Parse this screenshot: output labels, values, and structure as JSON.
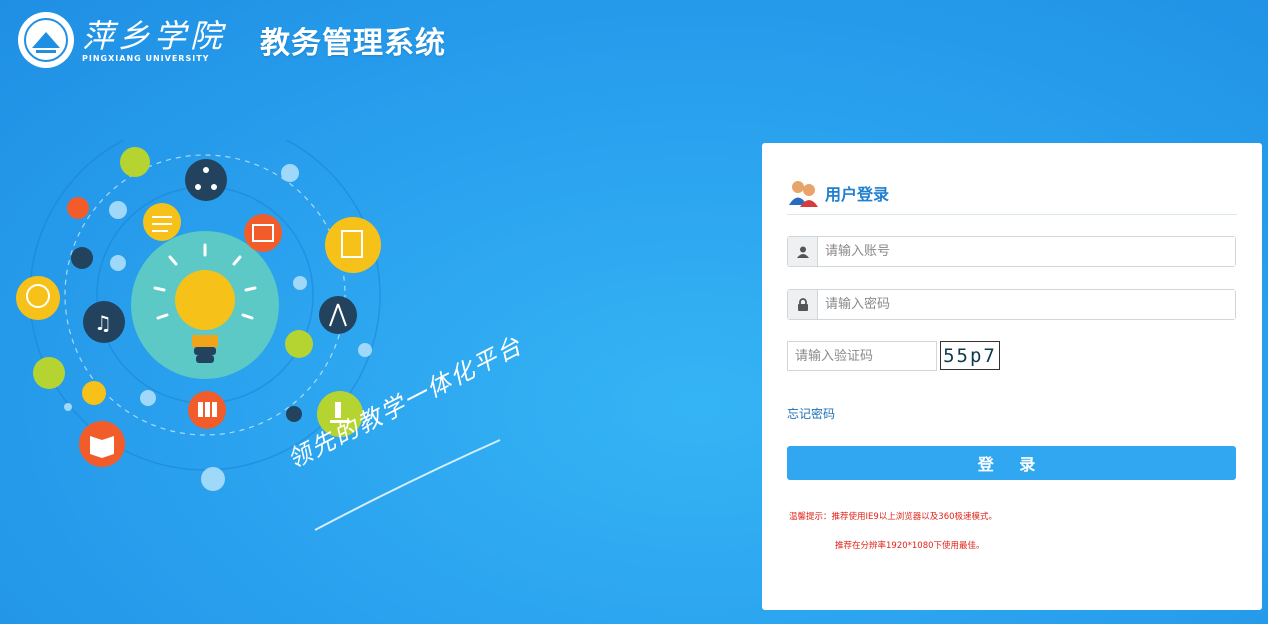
{
  "header": {
    "school_name_cn": "萍乡学院",
    "school_name_en": "PINGXIANG UNIVERSITY",
    "system_title": "教务管理系统"
  },
  "illustration": {
    "slogan": "领先的教学一体化平台",
    "icons": [
      "lightbulb-icon",
      "share-nodes-icon",
      "music-icon",
      "globe-icon",
      "compass-icon",
      "microscope-icon",
      "books-icon",
      "book-open-icon",
      "abacus-icon",
      "document-icon",
      "atom-icon"
    ]
  },
  "login": {
    "title": "用户登录",
    "username_placeholder": "请输入账号",
    "password_placeholder": "请输入密码",
    "captcha_placeholder": "请输入验证码",
    "captcha_text": "55p7",
    "forgot_link": "忘记密码",
    "login_button": "登 录",
    "tip_line1": "温馨提示：推荐使用IE9以上浏览器以及360极速模式。",
    "tip_line2": "推荐在分辨率1920*1080下使用最佳。"
  },
  "colors": {
    "accent": "#31a7f2",
    "title_blue": "#1f7fd0",
    "tip_red": "#e2231a"
  }
}
